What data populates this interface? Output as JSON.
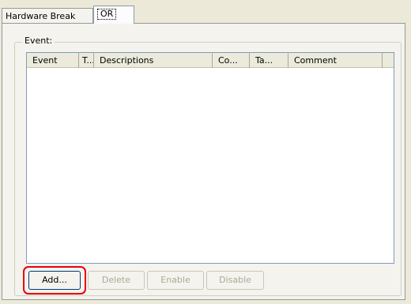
{
  "tabs": [
    {
      "label": "Hardware Break",
      "active": false
    },
    {
      "label": "OR",
      "active": true
    }
  ],
  "group": {
    "legend": "Event:"
  },
  "list": {
    "columns": [
      "Event",
      "T...",
      "Descriptions",
      "Co...",
      "Ta...",
      "Comment",
      ""
    ],
    "rows": []
  },
  "buttons": {
    "add": "Add...",
    "delete": "Delete",
    "enable": "Enable",
    "disable": "Disable"
  },
  "colors": {
    "highlight": "#e8000b",
    "window_bg": "#ece9d8",
    "panel_bg": "#f4f3ee"
  }
}
